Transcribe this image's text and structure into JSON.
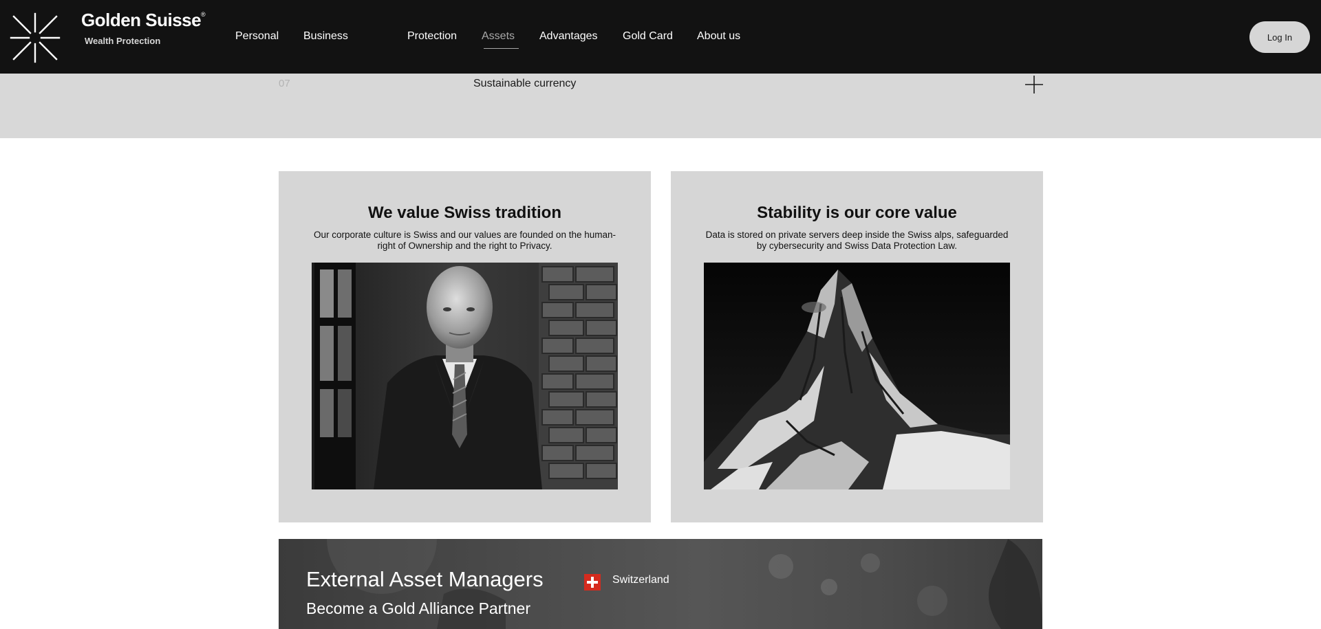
{
  "brand": {
    "name": "Golden Suisse",
    "registered": "®",
    "tagline": "Wealth Protection"
  },
  "nav": {
    "items": [
      {
        "label": "Personal"
      },
      {
        "label": "Business"
      },
      {
        "label": "Protection"
      },
      {
        "label": "Assets",
        "active": true
      },
      {
        "label": "Advantages"
      },
      {
        "label": "Gold Card"
      },
      {
        "label": "About us"
      }
    ],
    "login_label": "Log In"
  },
  "accordion": {
    "number": "07",
    "title": "Sustainable currency",
    "toggle_icon": "plus-icon"
  },
  "cards": [
    {
      "title": "We value Swiss tradition",
      "text": "Our corporate culture is Swiss and our values are founded on the human-right of Ownership and the right to Privacy."
    },
    {
      "title": "Stability is our core value",
      "text": "Data is stored on private servers deep inside the Swiss alps, safeguarded by cybersecurity and Swiss Data Protection Law."
    }
  ],
  "banner": {
    "title": "External Asset Managers",
    "subtitle": "Become a Gold Alliance Partner",
    "country": "Switzerland",
    "flag_icon": "swiss-flag-icon"
  },
  "colors": {
    "header_bg": "#121212",
    "panel_gray": "#d6d6d6",
    "nav_active": "#a9a9a9",
    "swiss_red": "#d52b1e"
  }
}
